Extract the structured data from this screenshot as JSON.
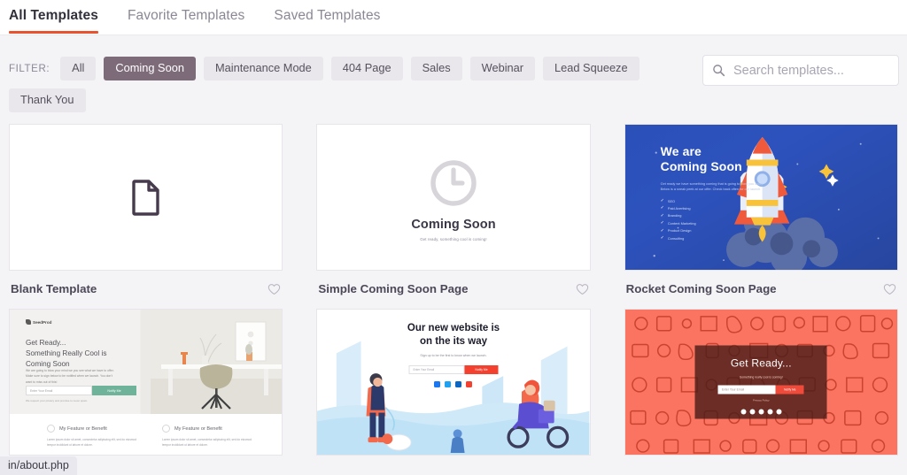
{
  "tabs": [
    {
      "label": "All Templates",
      "active": true
    },
    {
      "label": "Favorite Templates",
      "active": false
    },
    {
      "label": "Saved Templates",
      "active": false
    }
  ],
  "filter": {
    "label": "FILTER:",
    "chips": [
      {
        "label": "All",
        "active": false
      },
      {
        "label": "Coming Soon",
        "active": true
      },
      {
        "label": "Maintenance Mode",
        "active": false
      },
      {
        "label": "404 Page",
        "active": false
      },
      {
        "label": "Sales",
        "active": false
      },
      {
        "label": "Webinar",
        "active": false
      },
      {
        "label": "Lead Squeeze",
        "active": false
      },
      {
        "label": "Thank You",
        "active": false
      }
    ]
  },
  "search": {
    "placeholder": "Search templates...",
    "value": "",
    "icon": "search-icon"
  },
  "cards": [
    {
      "title": "Blank Template",
      "favorite_icon": "heart-outline-icon",
      "thumb": {
        "kind": "blank",
        "icon": "document-icon"
      }
    },
    {
      "title": "Simple Coming Soon Page",
      "favorite_icon": "heart-outline-icon",
      "thumb": {
        "kind": "simple-coming-soon",
        "icon": "clock-icon",
        "heading": "Coming Soon",
        "subtext": "Get ready, something cool is coming!"
      }
    },
    {
      "title": "Rocket Coming Soon Page",
      "favorite_icon": "heart-outline-icon",
      "thumb": {
        "kind": "rocket",
        "heading_line1": "We are",
        "heading_line2": "Coming Soon",
        "paragraph": "Get ready we have something coming that is going to blow you away. Below is a sneak peek at our offer. Check back often for our launch.",
        "list": [
          "SEO",
          "Paid Avertising",
          "Branding",
          "Content Marketing",
          "Product Design",
          "Consulting"
        ]
      }
    },
    {
      "title": "",
      "favorite_icon": "",
      "thumb": {
        "kind": "desk",
        "brand": "SeedProd",
        "heading_line1": "Get Ready...",
        "heading_line2": "Something Really Cool is",
        "heading_line3": "Coming Soon",
        "paragraph": "We are going to blow your mind we you see what we have to offer. Make sure to sign below to be notified when we launch. You don't want to miss out of this!",
        "input_placeholder": "Enter Your Email",
        "button_label": "Notify Me",
        "note": "We respect your privacy and promise to never spam.",
        "features": [
          {
            "title": "My Feature or Benefit",
            "body": "Lorem ipsum dolor sit amet, consectetur adipiscing elit, sed do eiusmod tempor incididunt ut labore et dolore."
          },
          {
            "title": "My Feature or Benefit",
            "body": "Lorem ipsum dolor sit amet, consectetur adipiscing elit, sed do eiusmod tempor incididunt ut labore et dolore."
          }
        ]
      }
    },
    {
      "title": "",
      "favorite_icon": "",
      "thumb": {
        "kind": "website",
        "heading_line1": "Our new website is",
        "heading_line2": "on the its way",
        "subtext": "Sign up to be the first to know when we launch.",
        "input_placeholder": "Enter Your Email",
        "button_label": "Notify Me",
        "socials": [
          "facebook-icon",
          "twitter-icon",
          "linkedin-icon",
          "youtube-icon"
        ]
      }
    },
    {
      "title": "",
      "favorite_icon": "",
      "thumb": {
        "kind": "coral",
        "heading": "Get Ready...",
        "subtext": "Something really cool is coming!",
        "input_placeholder": "Enter Your Email",
        "button_label": "Notify Me",
        "note": "Privacy Policy",
        "socials": [
          "facebook-icon",
          "twitter-icon",
          "instagram-icon",
          "pinterest-icon",
          "youtube-icon"
        ]
      }
    }
  ],
  "status_bar": {
    "text": "in/about.php"
  },
  "colors": {
    "accent": "#e8522e",
    "active_chip": "#7d6b7a",
    "page_bg": "#f4f3f6",
    "title": "#4c4857"
  }
}
